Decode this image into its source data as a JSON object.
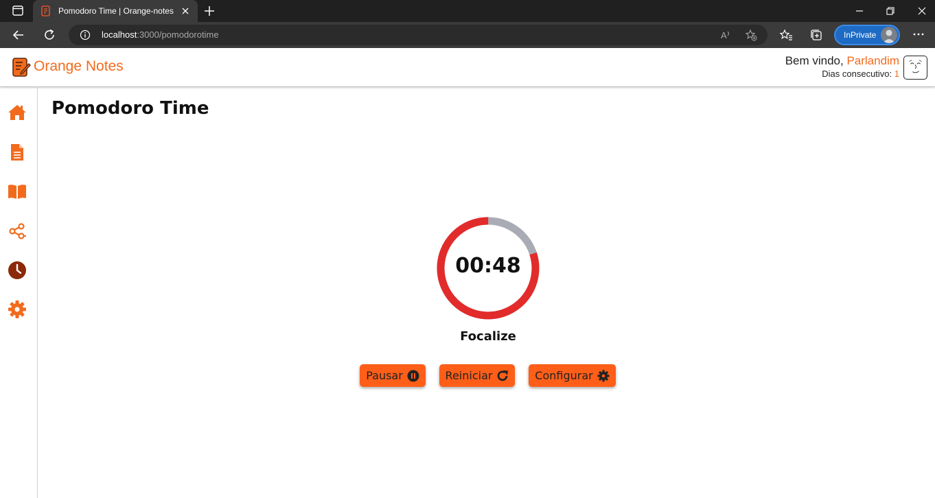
{
  "browser": {
    "tab_title": "Pomodoro Time | Orange-notes",
    "url_host": "localhost",
    "url_path": ":3000/pomodorotime",
    "inprivate_label": "InPrivate"
  },
  "app": {
    "brand": "Orange Notes",
    "welcome_prefix": "Bem vindo, ",
    "user_name": "Parlandim",
    "streak_label": "Dias consecutivo: ",
    "streak_value": "1",
    "accent_color": "#fe5e18"
  },
  "sidebar": {
    "items": [
      {
        "icon": "home-icon"
      },
      {
        "icon": "document-icon"
      },
      {
        "icon": "book-icon"
      },
      {
        "icon": "share-nodes-icon"
      },
      {
        "icon": "clock-icon",
        "active": true
      },
      {
        "icon": "gear-icon"
      }
    ]
  },
  "main": {
    "page_title": "Pomodoro Time",
    "timer": "00:48",
    "timer_progress": 0.8,
    "mode_label": "Focalize",
    "buttons": {
      "pause": "Pausar",
      "restart": "Reiniciar",
      "configure": "Configurar"
    }
  }
}
